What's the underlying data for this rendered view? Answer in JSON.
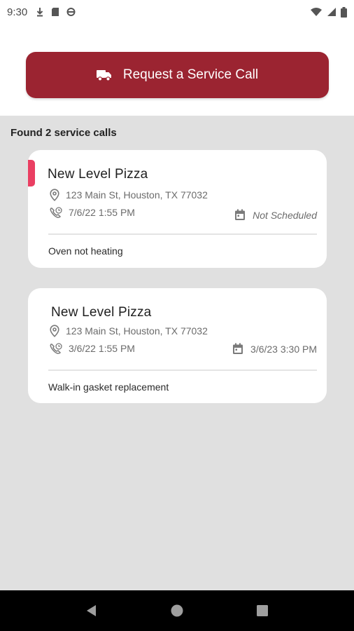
{
  "status_bar": {
    "time": "9:30"
  },
  "request_button": {
    "label": "Request a Service Call"
  },
  "results": {
    "found_text": "Found 2 service calls"
  },
  "calls": [
    {
      "name": "New Level Pizza",
      "address": "123 Main St, Houston, TX 77032",
      "created": "7/6/22 1:55 PM",
      "scheduled": "Not Scheduled",
      "description": "Oven not heating",
      "accent_color": "#ea3f62"
    },
    {
      "name": "New Level Pizza",
      "address": "123 Main St, Houston, TX 77032",
      "created": "3/6/22 1:55 PM",
      "scheduled": "3/6/23 3:30 PM",
      "description": "Walk-in gasket replacement"
    }
  ],
  "colors": {
    "brand": "#9b2431",
    "accent": "#ea3f62",
    "list_bg": "#e0e0e0"
  }
}
